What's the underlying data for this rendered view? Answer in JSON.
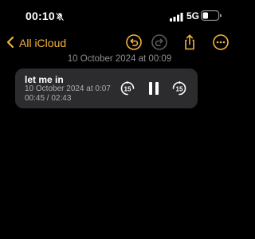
{
  "status": {
    "time": "00:10",
    "network": "5G",
    "icons": [
      "mute-bell-icon",
      "signal-bars-icon",
      "battery-icon"
    ]
  },
  "nav": {
    "back_label": "All iCloud",
    "icons": [
      "chevron-left-icon",
      "undo-icon",
      "redo-icon",
      "share-icon",
      "more-icon"
    ]
  },
  "note": {
    "date_header": "10 October 2024 at 00:09"
  },
  "recording": {
    "title": "let me in",
    "subtitle": "10 October 2024 at 0:07",
    "duration": "00:45 / 02:43",
    "controls": {
      "skip_back": "15",
      "skip_forward": "15",
      "icons": [
        "skip-back-15-icon",
        "pause-icon",
        "skip-forward-15-icon"
      ]
    }
  },
  "colors": {
    "accent": "#f4b33c",
    "background": "#000000",
    "card": "#2c2c2e",
    "secondary_text": "#8e8e93"
  }
}
